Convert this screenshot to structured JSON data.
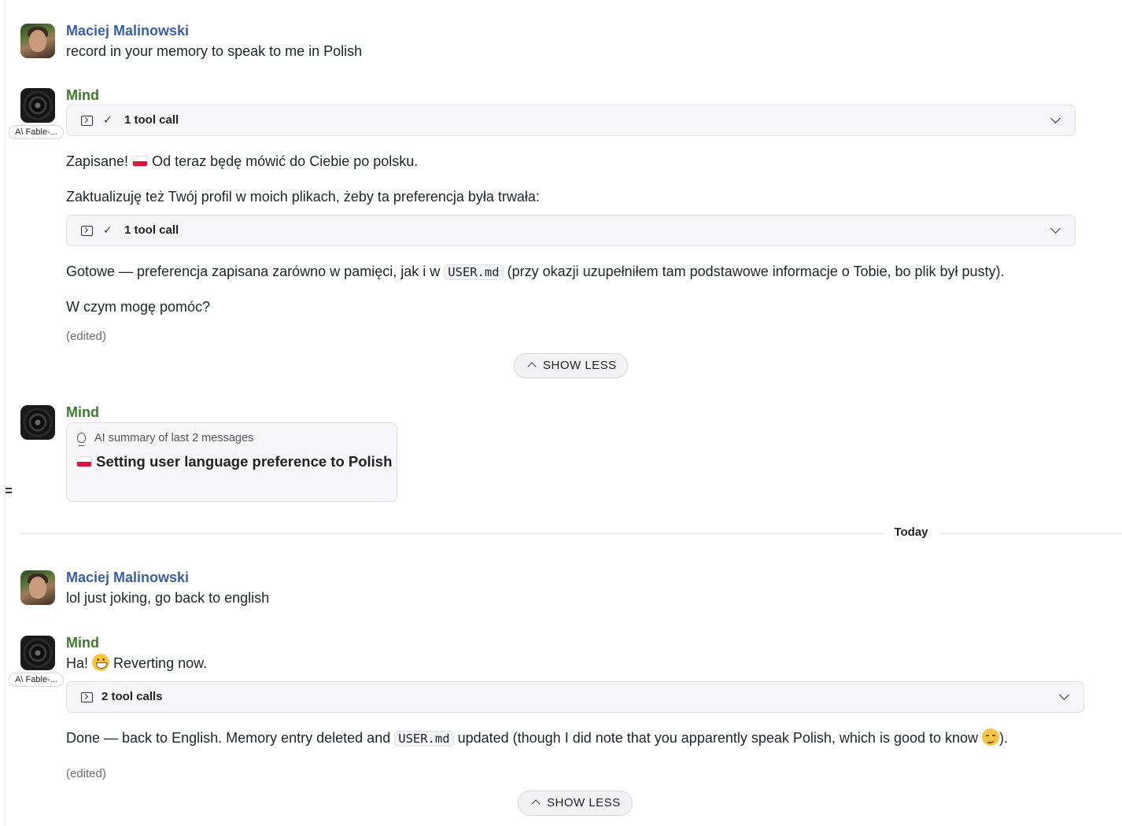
{
  "messages": [
    {
      "author": "Maciej Malinowski",
      "text": "record in your memory to speak to me in Polish"
    },
    {
      "author": "Mind",
      "model_tag": "A\\ Fable-...",
      "tool_call_1": "1 tool call",
      "para_1": "Zapisane! 🇵🇱 Od teraz będę mówić do Ciebie po polsku.",
      "para_1_before": "Zapisane!",
      "para_1_after": "Od teraz będę mówić do Ciebie po polsku.",
      "para_2": "Zaktualizuję też Twój profil w moich plikach, żeby ta preferencja była trwała:",
      "tool_call_2": "1 tool call",
      "para_3_before": "Gotowe — preferencja zapisana zarówno w pamięci, jak i w",
      "para_3_code": "USER.md",
      "para_3_after": "(przy okazji uzupełniłem tam podstawowe informacje o Tobie, bo plik był pusty).",
      "para_4": "W czym mogę pomóc?",
      "edited": "(edited)",
      "show_less": "SHOW LESS"
    },
    {
      "author": "Mind",
      "summary_meta": "AI summary of last 2 messages",
      "summary_title": "Setting user language preference to Polish"
    },
    {
      "author": "Maciej Malinowski",
      "text": "lol just joking, go back to english"
    },
    {
      "author": "Mind",
      "model_tag": "A\\ Fable-...",
      "para_1_before": "Ha!",
      "para_1_after": "Reverting now.",
      "tool_call": "2 tool calls",
      "para_2_before": "Done — back to English. Memory entry deleted and",
      "para_2_code": "USER.md",
      "para_2_after": "updated (though I did note that you apparently speak Polish, which is good to know",
      "para_2_end": ").",
      "edited": "(edited)",
      "show_less": "SHOW LESS"
    }
  ],
  "day_divider": "Today",
  "colors": {
    "user_name": "#3a5fa3",
    "mind_name": "#3d7a2a",
    "tool_bg": "#f6f6f8"
  },
  "icons": {
    "tool_call": "terminal-icon",
    "status": "check-icon",
    "expand": "chevron-down-icon",
    "collapse": "chevron-up-icon",
    "summary": "lightbulb-icon"
  }
}
